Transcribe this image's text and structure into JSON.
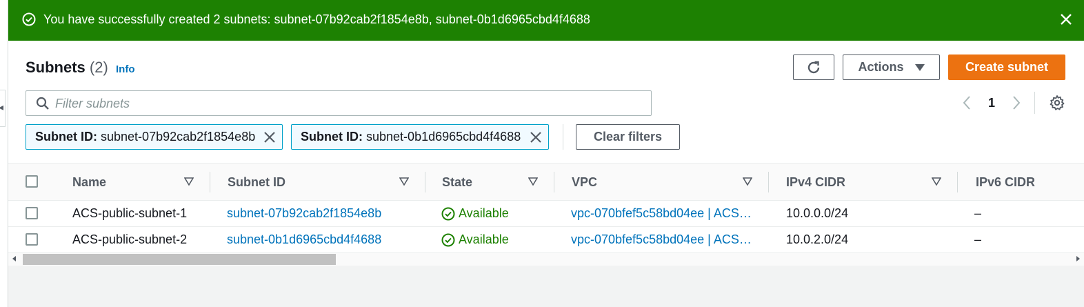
{
  "flash": {
    "message": "You have successfully created 2 subnets: subnet-07b92cab2f1854e8b, subnet-0b1d6965cbd4f4688",
    "color": "#1d8102"
  },
  "header": {
    "title": "Subnets",
    "count": "(2)",
    "info_label": "Info"
  },
  "toolbar": {
    "refresh_icon": "refresh-icon",
    "actions_label": "Actions",
    "create_label": "Create subnet",
    "accent": "#ec7211"
  },
  "search": {
    "placeholder": "Filter subnets",
    "value": ""
  },
  "pagination": {
    "current_page": "1"
  },
  "filters": [
    {
      "key": "Subnet ID:",
      "value": "subnet-07b92cab2f1854e8b"
    },
    {
      "key": "Subnet ID:",
      "value": "subnet-0b1d6965cbd4f4688"
    }
  ],
  "clear_filters_label": "Clear filters",
  "table": {
    "columns": [
      "Name",
      "Subnet ID",
      "State",
      "VPC",
      "IPv4 CIDR",
      "IPv6 CIDR"
    ],
    "rows": [
      {
        "name": "ACS-public-subnet-1",
        "subnet_id": "subnet-07b92cab2f1854e8b",
        "state": "Available",
        "vpc": "vpc-070bfef5c58bd04ee | ACS…",
        "ipv4": "10.0.0.0/24",
        "ipv6": "–"
      },
      {
        "name": "ACS-public-subnet-2",
        "subnet_id": "subnet-0b1d6965cbd4f4688",
        "state": "Available",
        "vpc": "vpc-070bfef5c58bd04ee | ACS…",
        "ipv4": "10.0.2.0/24",
        "ipv6": "–"
      }
    ]
  }
}
